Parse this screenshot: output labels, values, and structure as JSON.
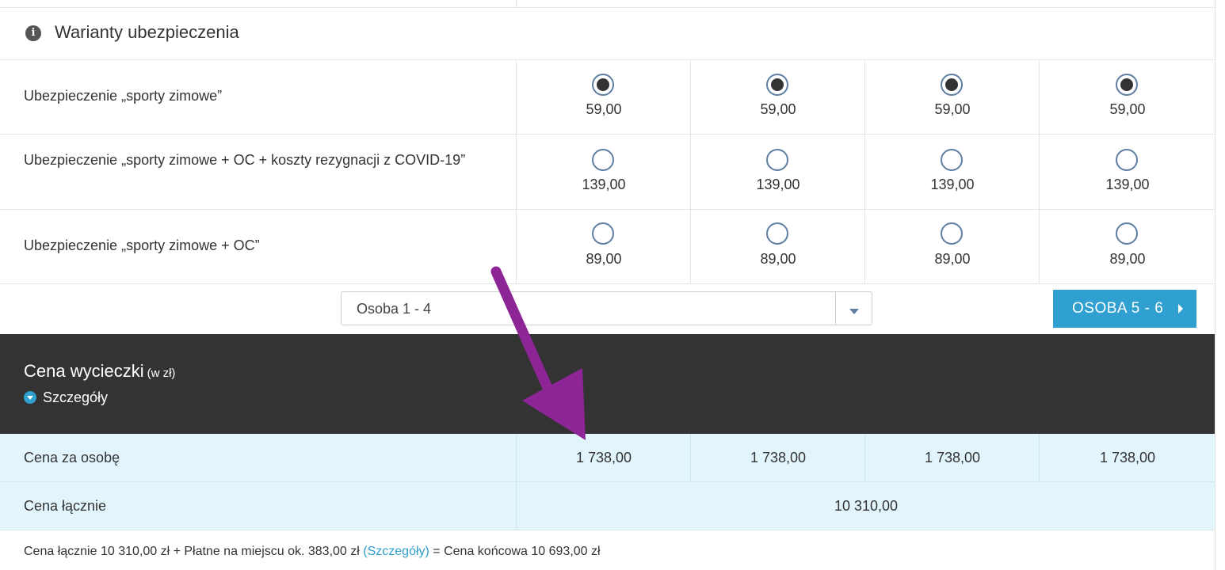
{
  "section": {
    "title": "Warianty ubezpieczenia"
  },
  "insurance_options": [
    {
      "label": "Ubezpieczenie „sporty zimowe”",
      "price": "59,00",
      "selected": true
    },
    {
      "label": "Ubezpieczenie „sporty zimowe + OC + koszty rezygnacji z COVID-19”",
      "price": "139,00",
      "selected": false
    },
    {
      "label": "Ubezpieczenie „sporty zimowe + OC”",
      "price": "89,00",
      "selected": false
    }
  ],
  "pager": {
    "select_value": "Osoba 1 - 4",
    "next_label": "OSOBA 5 - 6"
  },
  "price_section": {
    "title": "Cena wycieczki",
    "unit": "(w zł)",
    "details_label": "Szczegóły"
  },
  "per_person": {
    "label": "Cena za osobę",
    "values": [
      "1 738,00",
      "1 738,00",
      "1 738,00",
      "1 738,00"
    ]
  },
  "total": {
    "label": "Cena łącznie",
    "value": "10 310,00"
  },
  "footer": {
    "text_before": "Cena łącznie 10 310,00 zł + Płatne na miejscu ok. 383,00 zł",
    "link": "(Szczegóły)",
    "text_after": " = Cena końcowa 10 693,00 zł"
  },
  "colors": {
    "accent": "#2fa0d0",
    "dark_band": "#333333",
    "highlight_row": "#e2f5fc",
    "annotation_arrow": "#8e2596"
  }
}
